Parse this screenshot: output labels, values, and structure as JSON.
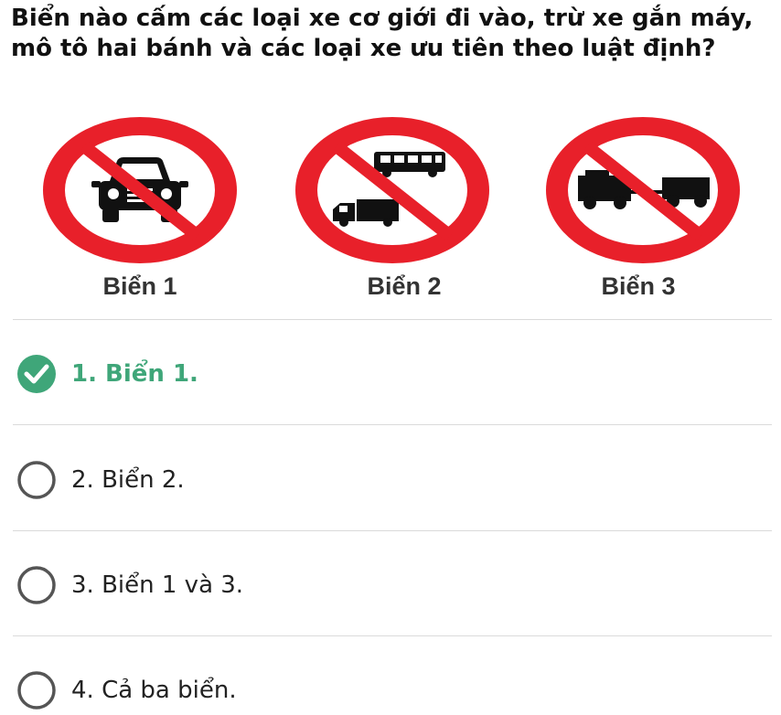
{
  "question": "Biển nào cấm các loại xe cơ giới đi vào, trừ xe gắn máy, mô tô hai bánh và các loại xe ưu tiên theo luật định?",
  "signs": [
    {
      "label": "Biển 1",
      "icon": "no-car-sign-icon"
    },
    {
      "label": "Biển 2",
      "icon": "no-truck-bus-sign-icon"
    },
    {
      "label": "Biển 3",
      "icon": "no-tractor-trailer-sign-icon"
    }
  ],
  "options": [
    {
      "label": "1. Biển 1.",
      "selected": true,
      "correct": true
    },
    {
      "label": "2. Biển 2.",
      "selected": false,
      "correct": false
    },
    {
      "label": "3. Biển 1 và 3.",
      "selected": false,
      "correct": false
    },
    {
      "label": "4. Cả ba biển.",
      "selected": false,
      "correct": false
    }
  ],
  "colors": {
    "sign_red": "#e8202a",
    "correct_green": "#3fa679",
    "radio_gray": "#555555",
    "divider": "#dadada"
  }
}
